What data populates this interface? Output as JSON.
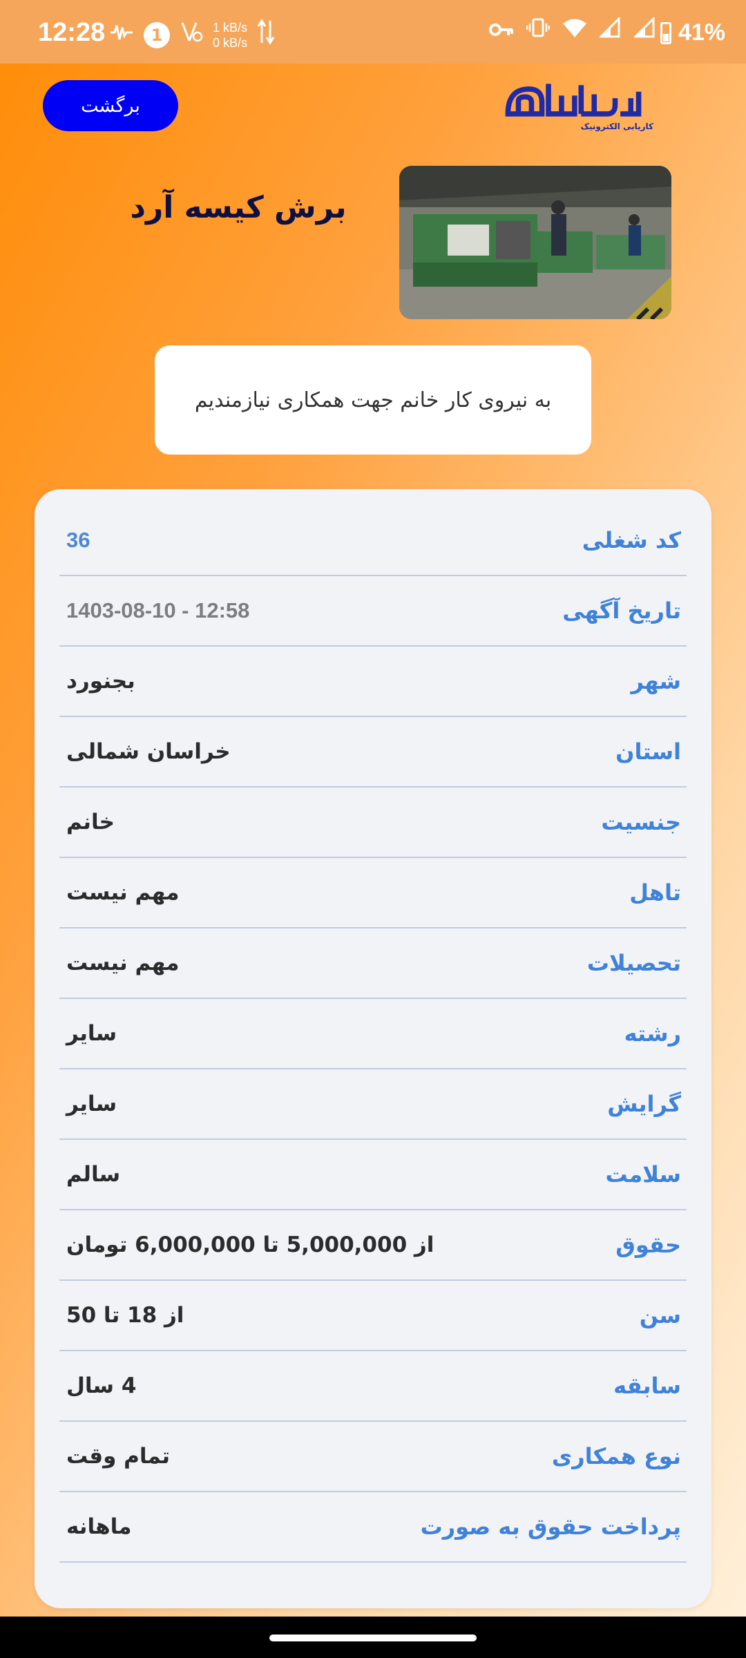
{
  "status_bar": {
    "time": "12:28",
    "speed_up": "1 kB/s",
    "speed_down": "0 kB/s",
    "notification_badge": "1",
    "battery": "41%",
    "icons": [
      "activity-icon",
      "badge-icon",
      "data-off-icon",
      "transfer-arrows-icon",
      "key-icon",
      "vibrate-icon",
      "wifi-icon",
      "signal-icon",
      "signal-icon",
      "battery-icon"
    ]
  },
  "header": {
    "back_label": "برگشت",
    "logo_text": "محیاافزار",
    "logo_subtitle": "کاریابی الکترونیک"
  },
  "job": {
    "title": "برش کیسه آرد",
    "description": "به نیروی کار خانم جهت همکاری نیازمندیم"
  },
  "details": [
    {
      "label": "کد شغلی",
      "value": "36"
    },
    {
      "label": "تاریخ آگهی",
      "value": "1403-08-10 - 12:58"
    },
    {
      "label": "شهر",
      "value": "بجنورد"
    },
    {
      "label": "استان",
      "value": "خراسان شمالی"
    },
    {
      "label": "جنسیت",
      "value": "خانم"
    },
    {
      "label": "تاهل",
      "value": "مهم نیست"
    },
    {
      "label": "تحصیلات",
      "value": "مهم نیست"
    },
    {
      "label": "رشته",
      "value": "سایر"
    },
    {
      "label": "گرایش",
      "value": "سایر"
    },
    {
      "label": "سلامت",
      "value": "سالم"
    },
    {
      "label": "حقوق",
      "value": "از 5,000,000 تا 6,000,000 تومان"
    },
    {
      "label": "سن",
      "value": "از 18 تا 50"
    },
    {
      "label": "سابقه",
      "value": "4 سال"
    },
    {
      "label": "نوع همکاری",
      "value": "تمام وقت"
    },
    {
      "label": "پرداخت حقوق به صورت",
      "value": "ماهانه"
    }
  ],
  "colors": {
    "status_bar": "#f5a65a",
    "back_button": "#0000f5",
    "label_blue": "#3f82d7",
    "logo_blue": "#1e2aa8"
  }
}
